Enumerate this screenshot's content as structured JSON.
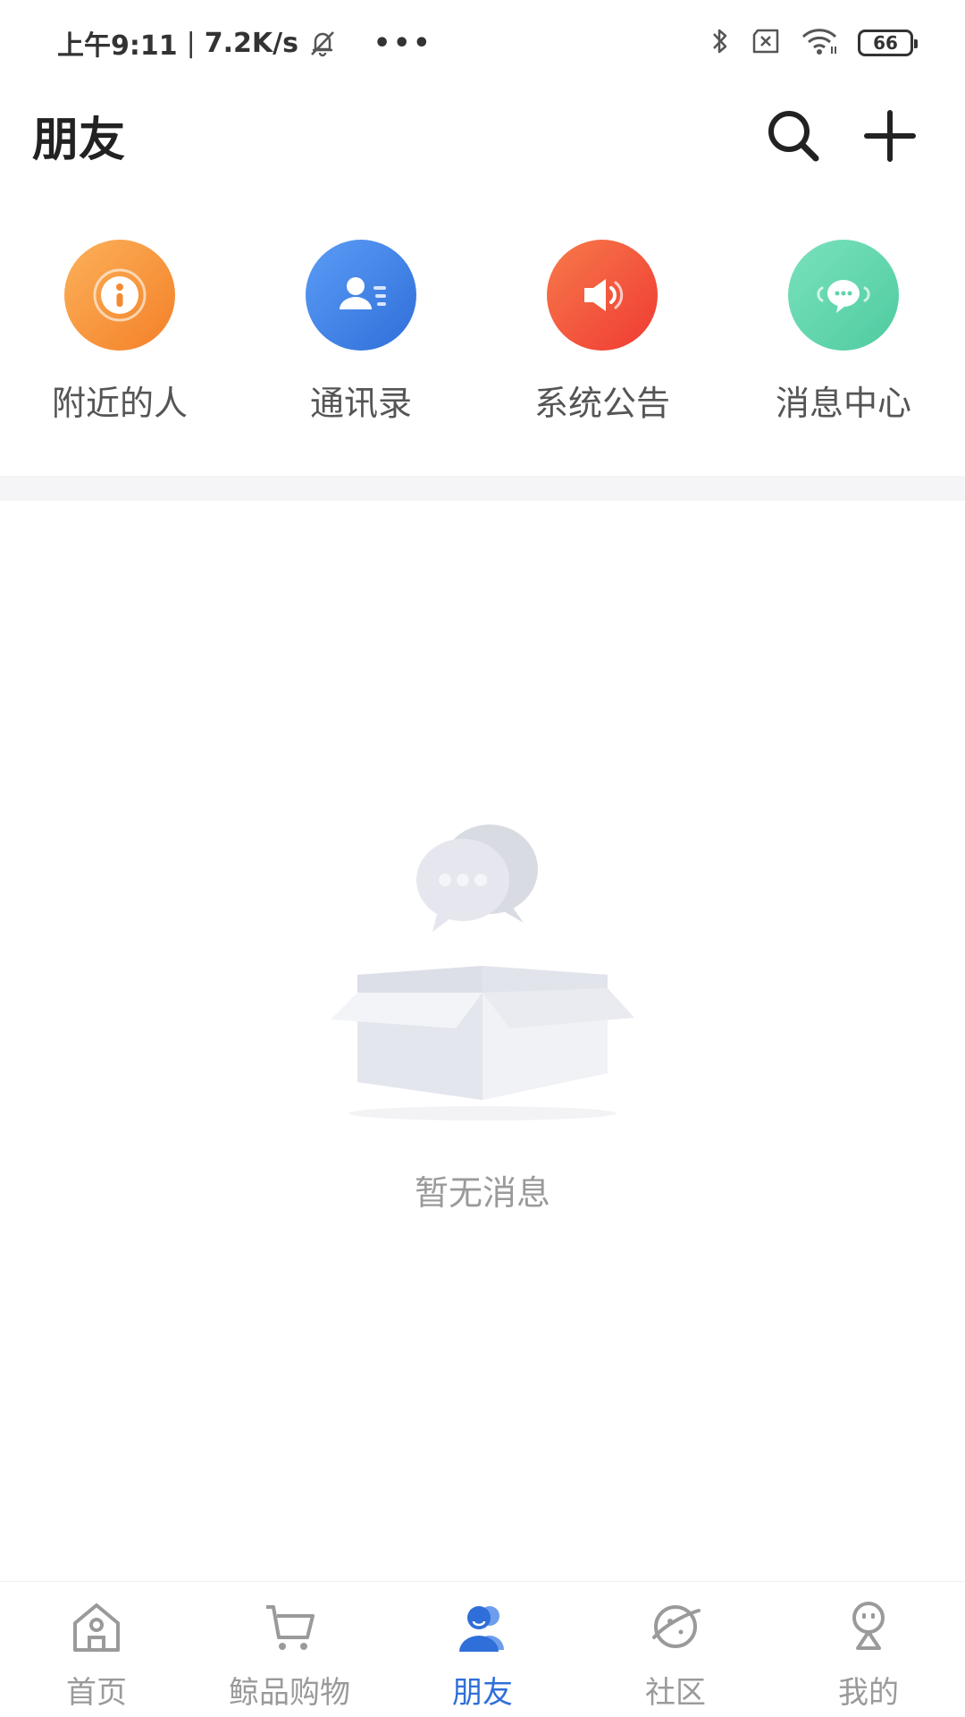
{
  "status_bar": {
    "time": "上午9:11",
    "separator": "|",
    "net_speed": "7.2K/s",
    "more": "•••",
    "battery": "66"
  },
  "header": {
    "title": "朋友"
  },
  "quick_entries": [
    {
      "label": "附近的人",
      "color": "#f7943a"
    },
    {
      "label": "通讯录",
      "color": "#3f83ec"
    },
    {
      "label": "系统公告",
      "color": "#f2573a"
    },
    {
      "label": "消息中心",
      "color": "#5fd4a8"
    }
  ],
  "empty_state": {
    "text": "暂无消息"
  },
  "bottom_nav": {
    "items": [
      {
        "label": "首页"
      },
      {
        "label": "鲸品购物"
      },
      {
        "label": "朋友"
      },
      {
        "label": "社区"
      },
      {
        "label": "我的"
      }
    ],
    "active_color": "#2f6fd9",
    "inactive_color": "#9a9a9a"
  }
}
